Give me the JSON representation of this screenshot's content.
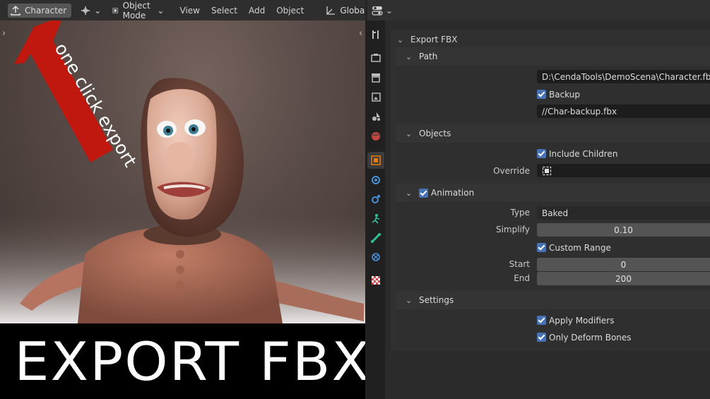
{
  "toolbar": {
    "export_label": "Character",
    "mode_label": "Object Mode",
    "menus": [
      "View",
      "Select",
      "Add",
      "Object"
    ],
    "orientation_label": "Global"
  },
  "overlay": {
    "arrow_text": "one click export",
    "banner_text": "EXPORT FBX",
    "arrow_color": "#c0170f"
  },
  "sidebar_tabs": [
    "tool-icon",
    "render-icon",
    "output-icon",
    "view-layer-icon",
    "scene-icon",
    "world-icon",
    "object-icon",
    "modifier-icon",
    "particles-icon",
    "physics-icon",
    "constraints-icon",
    "data-icon",
    "texture-icon"
  ],
  "panel": {
    "title": "Export FBX",
    "path": {
      "header": "Path",
      "file_path": "D:\\CendaTools\\DemoScena\\Character.fbx",
      "backup_label": "Backup",
      "backup_checked": true,
      "backup_path": "//Char-backup.fbx"
    },
    "objects": {
      "header": "Objects",
      "include_children_label": "Include Children",
      "include_children_checked": true,
      "override_label": "Override"
    },
    "animation": {
      "header": "Animation",
      "enabled": true,
      "type_label": "Type",
      "type_value": "Baked",
      "simplify_label": "Simplify",
      "simplify_value": "0.10",
      "custom_range_label": "Custom Range",
      "custom_range_checked": true,
      "start_label": "Start",
      "start_value": "0",
      "end_label": "End",
      "end_value": "200"
    },
    "settings": {
      "header": "Settings",
      "apply_modifiers_label": "Apply Modifiers",
      "apply_modifiers_checked": true,
      "only_deform_label": "Only Deform Bones",
      "only_deform_checked": true
    }
  },
  "colors": {
    "accent_blue": "#4772b3",
    "panel_bg": "#303030",
    "active_tab_icon": "#e87d0d"
  }
}
